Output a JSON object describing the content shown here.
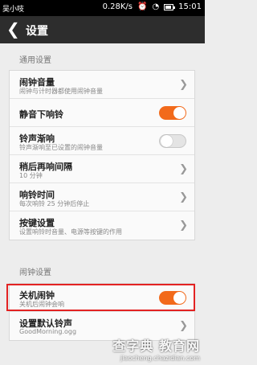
{
  "status_bar": {
    "carrier": "吴小吱",
    "speed": "0.28K/s",
    "time": "15:01"
  },
  "title_bar": {
    "back_icon": "chevron-left-icon",
    "title": "设置"
  },
  "general_section": {
    "title": "通用设置",
    "items": [
      {
        "title": "闹钟音量",
        "subtitle": "闹钟与计时器都使用闹钟音量",
        "control": "chevron"
      },
      {
        "title": "静音下响铃",
        "subtitle": "",
        "control": "toggle",
        "state": "on"
      },
      {
        "title": "铃声渐响",
        "subtitle": "铃声渐响至已设置的闹钟音量",
        "control": "toggle",
        "state": "off"
      },
      {
        "title": "稍后再响间隔",
        "subtitle": "10 分钟",
        "control": "chevron"
      },
      {
        "title": "响铃时间",
        "subtitle": "每次响铃 25 分钟后停止",
        "control": "chevron"
      },
      {
        "title": "按键设置",
        "subtitle": "设置响铃时音量、电源等按键的作用",
        "control": "chevron"
      }
    ]
  },
  "alarm_section": {
    "title": "闹钟设置",
    "items": [
      {
        "title": "关机闹钟",
        "subtitle": "关机后闹钟会响",
        "control": "toggle",
        "state": "on"
      },
      {
        "title": "设置默认铃声",
        "subtitle": "GoodMorning.ogg",
        "control": "chevron"
      }
    ]
  },
  "watermark": {
    "text": "查字典 教育网",
    "url": "jiaocheng.chazidian.com"
  },
  "colors": {
    "accent": "#f26a1b",
    "highlight_box": "#e32222",
    "title_bar": "#2d2d2d"
  }
}
